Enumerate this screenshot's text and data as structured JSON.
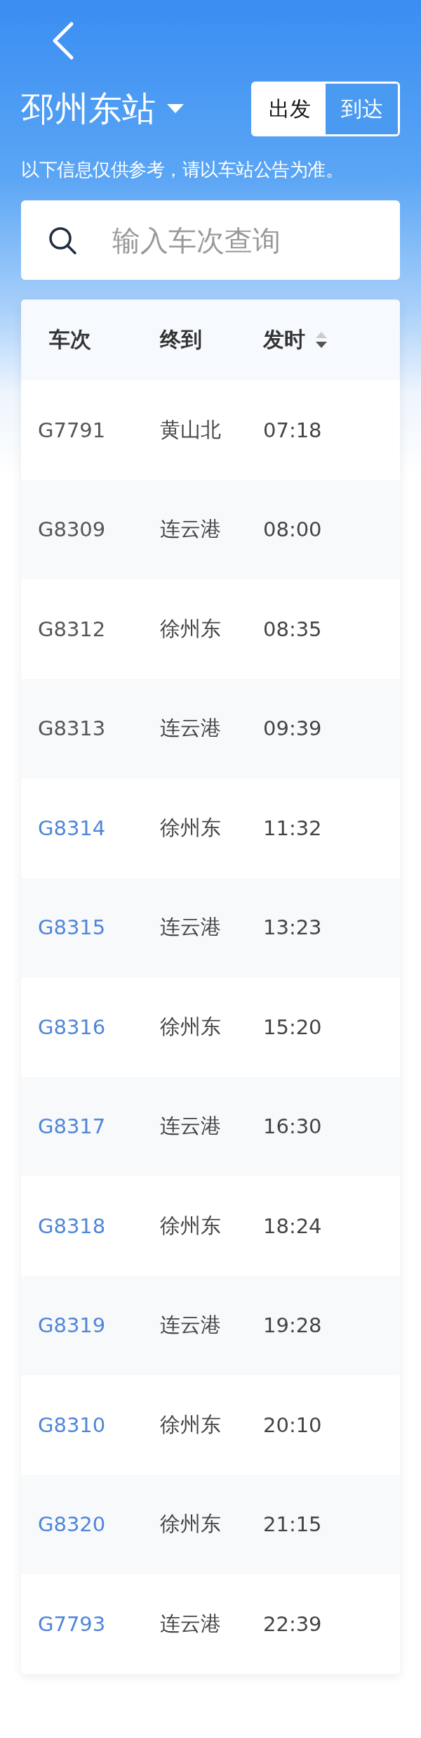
{
  "header": {
    "station": "邳州东站",
    "modes": [
      {
        "label": "出发",
        "selected": true
      },
      {
        "label": "到达",
        "selected": false
      }
    ],
    "notice": "以下信息仅供参考，请以车站公告为准。"
  },
  "search": {
    "placeholder": "输入车次查询"
  },
  "table": {
    "columns": [
      {
        "label": "车次"
      },
      {
        "label": "终到"
      },
      {
        "label": "发时",
        "sorted": true,
        "descending": true
      }
    ],
    "rows": [
      {
        "train": "G7791",
        "destination": "黄山北",
        "time": "07:18",
        "departed": true
      },
      {
        "train": "G8309",
        "destination": "连云港",
        "time": "08:00",
        "departed": true
      },
      {
        "train": "G8312",
        "destination": "徐州东",
        "time": "08:35",
        "departed": true
      },
      {
        "train": "G8313",
        "destination": "连云港",
        "time": "09:39",
        "departed": true
      },
      {
        "train": "G8314",
        "destination": "徐州东",
        "time": "11:32",
        "departed": false
      },
      {
        "train": "G8315",
        "destination": "连云港",
        "time": "13:23",
        "departed": false
      },
      {
        "train": "G8316",
        "destination": "徐州东",
        "time": "15:20",
        "departed": false
      },
      {
        "train": "G8317",
        "destination": "连云港",
        "time": "16:30",
        "departed": false
      },
      {
        "train": "G8318",
        "destination": "徐州东",
        "time": "18:24",
        "departed": false
      },
      {
        "train": "G8319",
        "destination": "连云港",
        "time": "19:28",
        "departed": false
      },
      {
        "train": "G8310",
        "destination": "徐州东",
        "time": "20:10",
        "departed": false
      },
      {
        "train": "G8320",
        "destination": "徐州东",
        "time": "21:15",
        "departed": false
      },
      {
        "train": "G7793",
        "destination": "连云港",
        "time": "22:39",
        "departed": false
      }
    ]
  }
}
